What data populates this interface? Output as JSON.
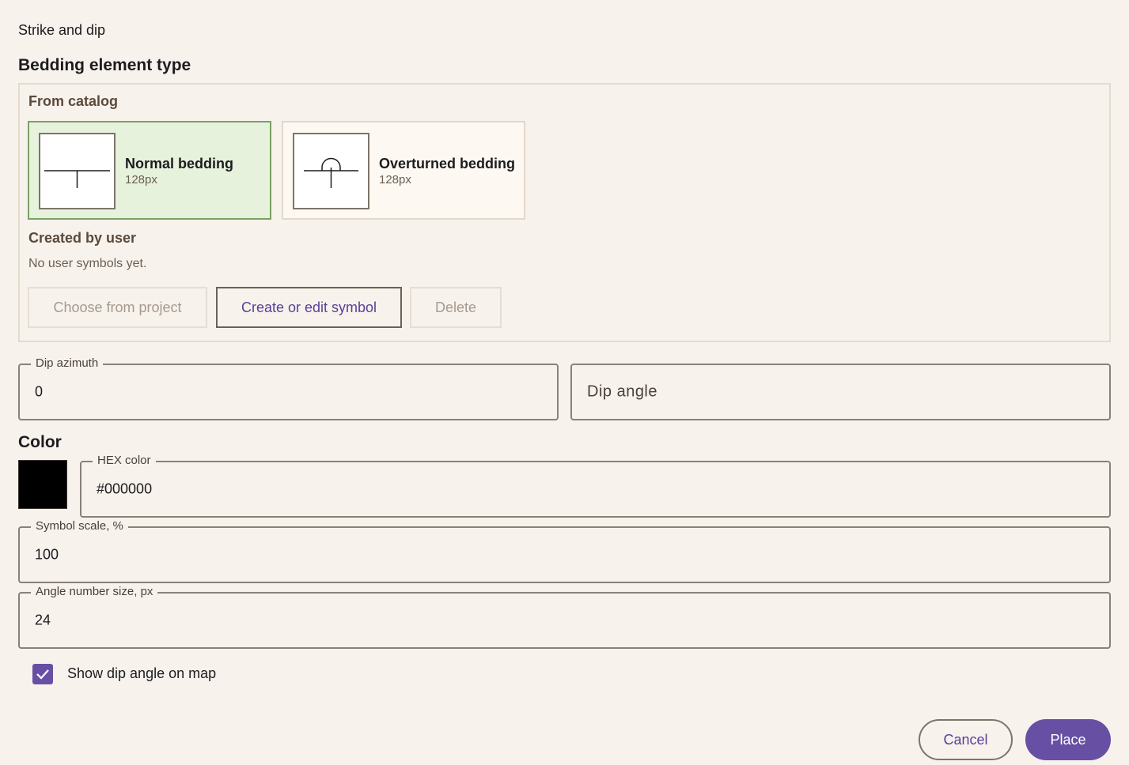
{
  "dialog": {
    "title": "Strike and dip"
  },
  "bedding": {
    "section_title": "Bedding element type",
    "from_catalog_label": "From catalog",
    "catalog": [
      {
        "name": "Normal bedding",
        "size": "128px",
        "icon": "normal-bedding-symbol",
        "selected": true
      },
      {
        "name": "Overturned bedding",
        "size": "128px",
        "icon": "overturned-bedding-symbol",
        "selected": false
      }
    ],
    "created_by_user_label": "Created by user",
    "empty_text": "No user symbols yet.",
    "buttons": {
      "choose_from_project": "Choose from project",
      "create_or_edit": "Create or edit symbol",
      "delete": "Delete"
    }
  },
  "fields": {
    "dip_azimuth": {
      "label": "Dip azimuth",
      "value": "0"
    },
    "dip_angle": {
      "placeholder": "Dip angle"
    },
    "hex_color": {
      "label": "HEX color",
      "value": "#000000"
    },
    "symbol_scale": {
      "label": "Symbol scale, %",
      "value": "100"
    },
    "angle_number_size": {
      "label": "Angle number size, px",
      "value": "24"
    }
  },
  "color": {
    "section_title": "Color",
    "swatch": "#000000"
  },
  "show_dip_angle": {
    "label": "Show dip angle on map",
    "checked": true
  },
  "actions": {
    "cancel": "Cancel",
    "place": "Place"
  },
  "theme": {
    "background": "#f7f2ec",
    "primary": "#6750a4",
    "selected_card": "#e6f2dc"
  }
}
